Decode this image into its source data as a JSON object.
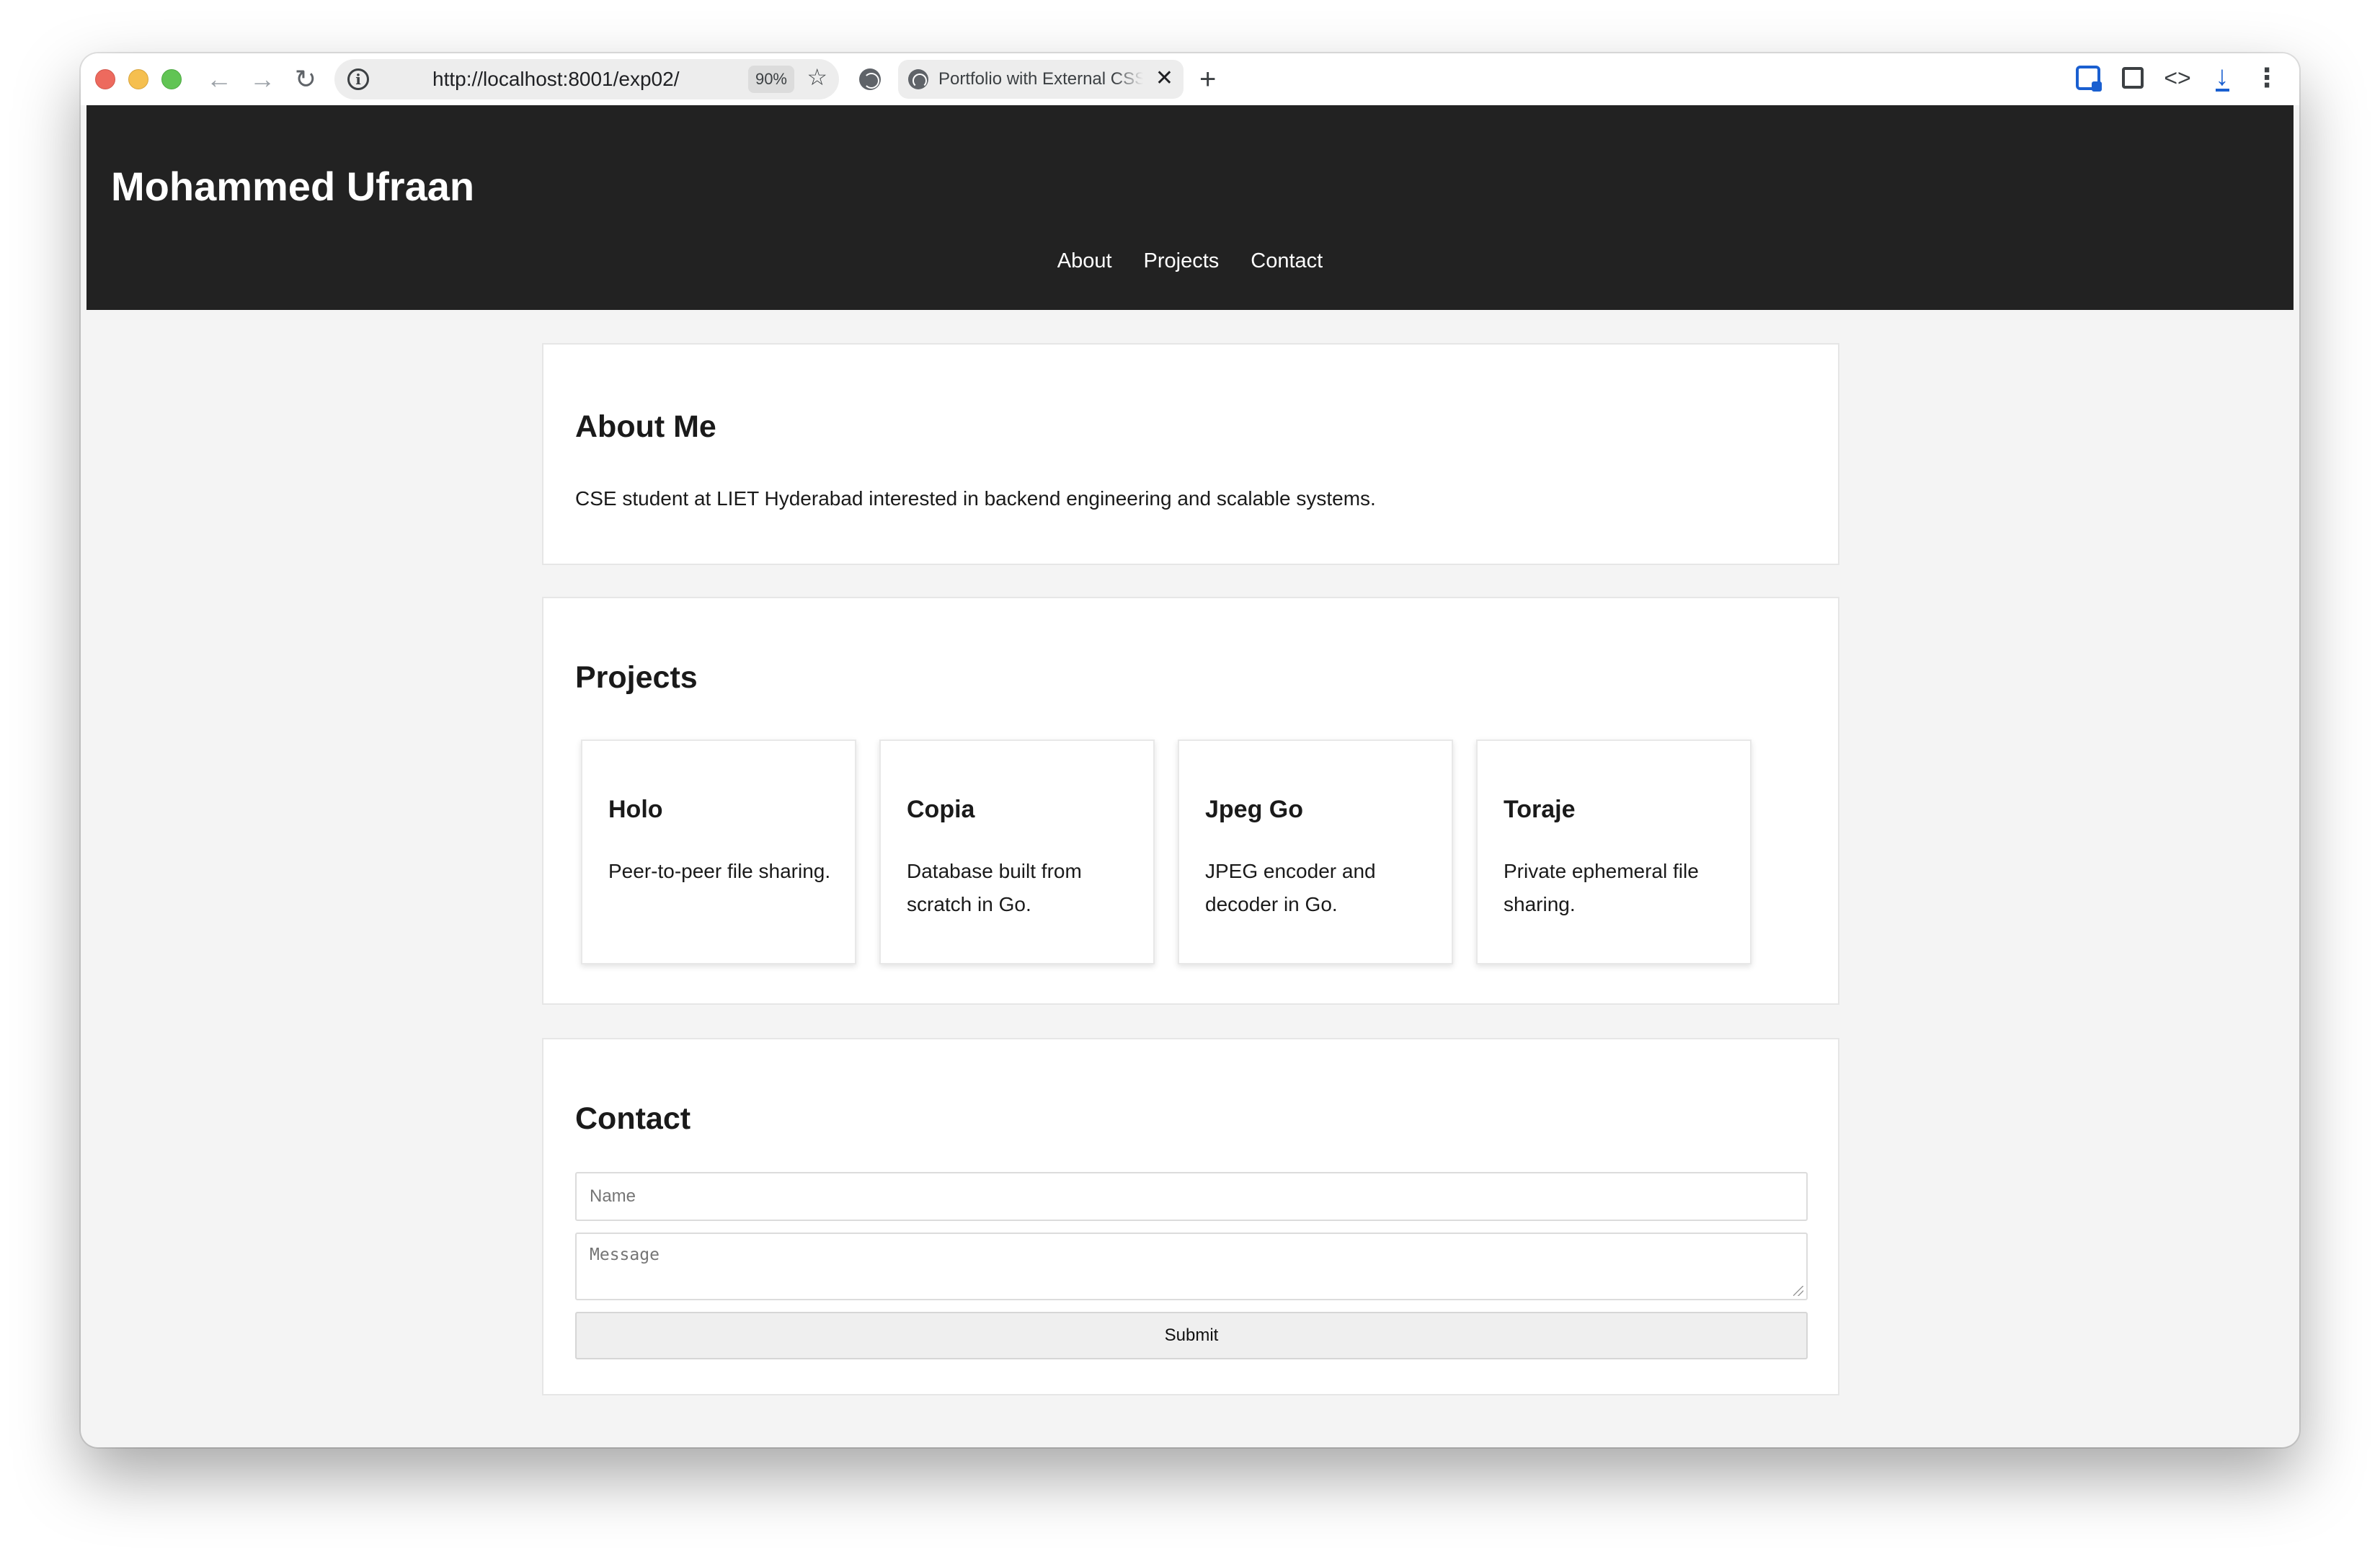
{
  "browser": {
    "url": "http://localhost:8001/exp02/",
    "zoom": "90%",
    "tab_title": "Portfolio with External CSS",
    "icons": {
      "back": "arrow-left-icon",
      "forward": "arrow-right-icon",
      "reload": "reload-icon",
      "info": "info-icon",
      "bookmark": "star-icon",
      "new_tab": "plus-icon",
      "close_tab": "close-icon",
      "extension": "extension-icon",
      "puzzle": "puzzle-icon",
      "devtools": "code-icon",
      "download": "download-icon",
      "menu": "kebab-menu-icon"
    },
    "traffic_colors": {
      "close": "#ed6a5e",
      "minimize": "#f5bf4f",
      "maximize": "#61c454"
    }
  },
  "site": {
    "title": "Mohammed Ufraan",
    "nav": [
      {
        "label": "About"
      },
      {
        "label": "Projects"
      },
      {
        "label": "Contact"
      }
    ],
    "colors": {
      "header_bg": "#222222",
      "page_bg": "#f4f4f4"
    }
  },
  "about": {
    "heading": "About Me",
    "text": "CSE student at LIET Hyderabad interested in backend engineering and scalable systems."
  },
  "projects": {
    "heading": "Projects",
    "items": [
      {
        "name": "Holo",
        "description": "Peer-to-peer file sharing."
      },
      {
        "name": "Copia",
        "description": "Database built from scratch in Go."
      },
      {
        "name": "Jpeg Go",
        "description": "JPEG encoder and decoder in Go."
      },
      {
        "name": "Toraje",
        "description": "Private ephemeral file sharing."
      }
    ]
  },
  "contact": {
    "heading": "Contact",
    "name_placeholder": "Name",
    "message_placeholder": "Message",
    "submit_label": "Submit"
  }
}
